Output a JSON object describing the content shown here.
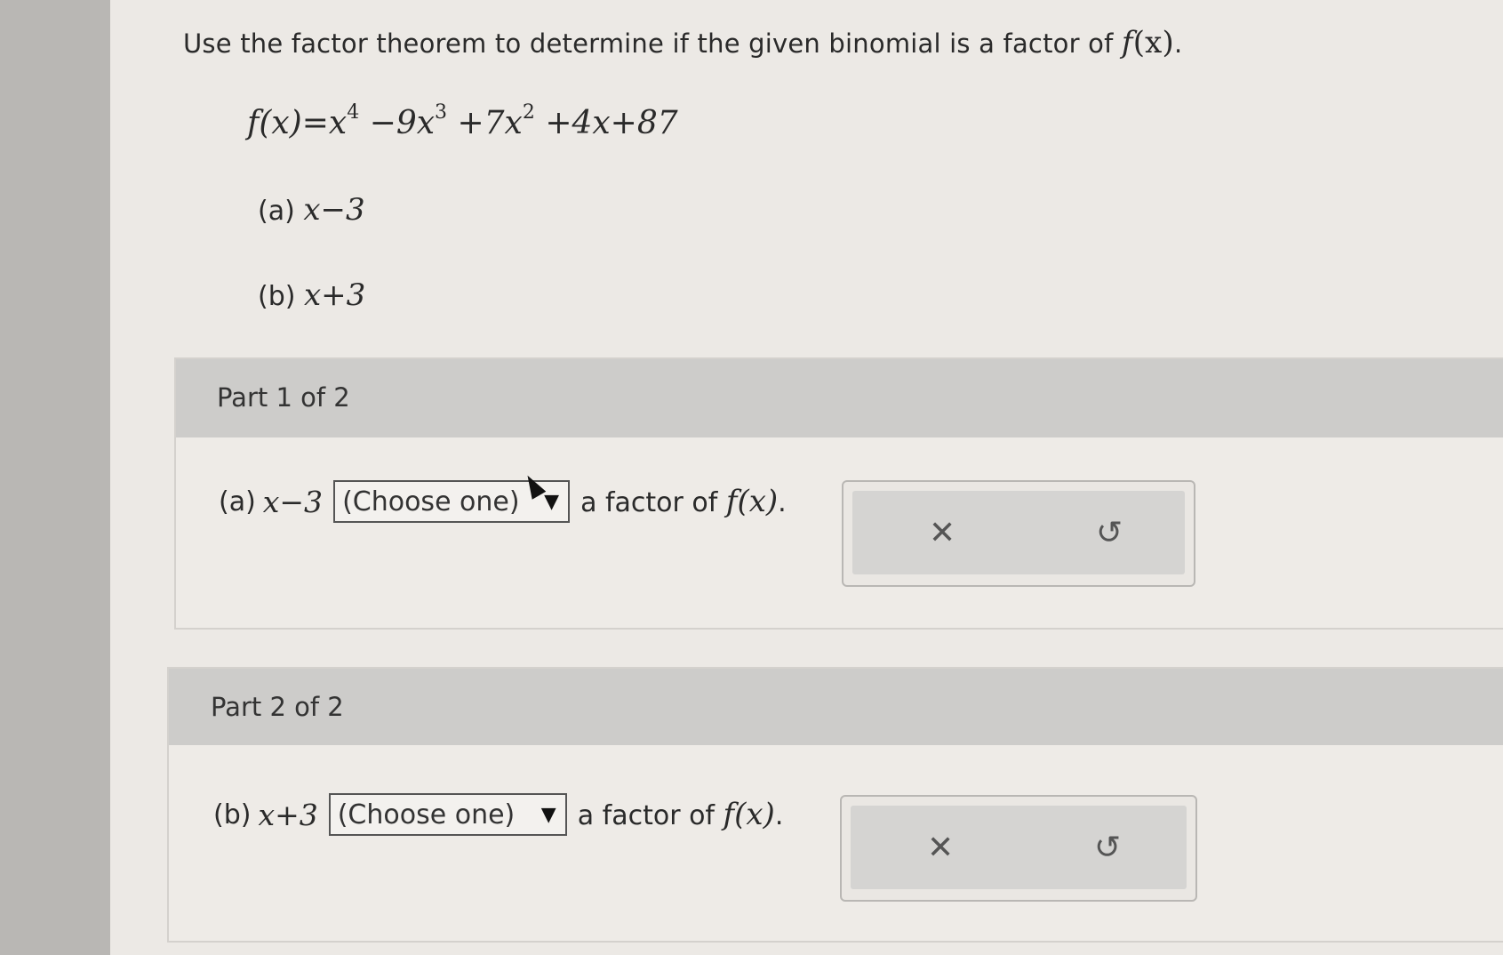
{
  "question": {
    "text": "Use the factor theorem to determine if the given binomial is a factor of",
    "function": "f",
    "var": "(x)",
    "period": "."
  },
  "equation": {
    "lhs": "f(x)",
    "eq": "=",
    "x": "x",
    "p4": "4",
    "t2": "−9x",
    "p3": "3",
    "t3": "+7x",
    "p2": "2",
    "t4": "+4x+87"
  },
  "choices": {
    "a": {
      "label": "(a)",
      "expr": "x−3"
    },
    "b": {
      "label": "(b)",
      "expr": "x+3"
    }
  },
  "parts": [
    {
      "title": "Part 1 of 2",
      "label": "(a)",
      "expr": "x−3",
      "select_value": "(Choose one)",
      "suffix_text": "a factor of",
      "suffix_math": "f(x)",
      "suffix_end": ".",
      "clear_icon": "✕",
      "reset_icon": "↺"
    },
    {
      "title": "Part 2 of 2",
      "label": "(b)",
      "expr": "x+3",
      "select_value": "(Choose one)",
      "suffix_text": "a factor of",
      "suffix_math": "f(x)",
      "suffix_end": ".",
      "clear_icon": "✕",
      "reset_icon": "↺"
    }
  ],
  "icons": {
    "dropdown": "chevron-down-icon",
    "clear": "close-icon",
    "reset": "undo-icon"
  },
  "colors": {
    "header": "#cdccca",
    "page": "#ece9e5",
    "margin": "#b9b7b4"
  }
}
